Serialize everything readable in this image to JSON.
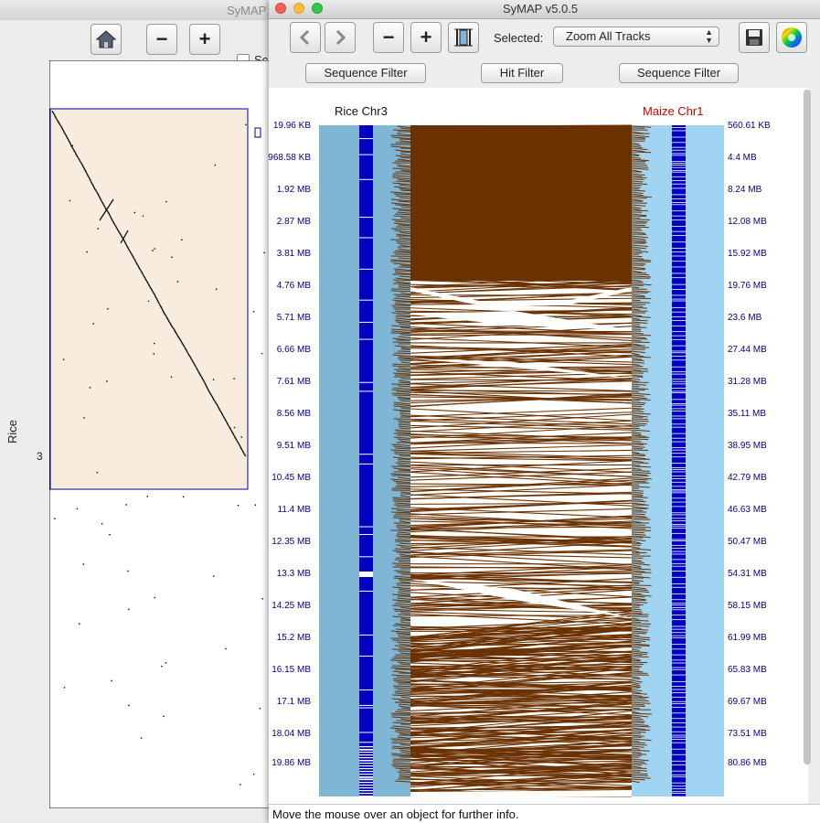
{
  "back_window": {
    "title": "SyMAP",
    "checkbox_label": "Sc",
    "y_axis_label": "Rice",
    "chromosome_label": "3",
    "icons": [
      "home-icon",
      "zoom-out-icon",
      "zoom-in-icon"
    ]
  },
  "window": {
    "title": "SyMAP v5.0.5",
    "controls": [
      "close",
      "minimize",
      "zoom"
    ],
    "colors": {
      "close": "#fc605c",
      "minimize": "#fdbc40",
      "zoom": "#34c84a"
    }
  },
  "toolbar": {
    "selected_label": "Selected:",
    "zoom_select_value": "Zoom All Tracks",
    "icons": [
      "back-arrow-icon",
      "forward-arrow-icon",
      "zoom-out-icon",
      "zoom-in-icon",
      "fit-track-icon",
      "save-icon",
      "color-wheel-icon"
    ]
  },
  "filters": {
    "left_sequence_filter": "Sequence Filter",
    "hit_filter": "Hit Filter",
    "right_sequence_filter": "Sequence Filter"
  },
  "tracks": {
    "reference": {
      "title": "Rice Chr3",
      "ticks": [
        "19.96 KB",
        "968.58 KB",
        "1.92 MB",
        "2.87 MB",
        "3.81 MB",
        "4.76 MB",
        "5.71 MB",
        "6.66 MB",
        "7.61 MB",
        "8.56 MB",
        "9.51 MB",
        "10.45 MB",
        "11.4 MB",
        "12.35 MB",
        "13.3 MB",
        "14.25 MB",
        "15.2 MB",
        "16.15 MB",
        "17.1 MB",
        "18.04 MB",
        "19.86 MB"
      ],
      "color": "#7fb6d6",
      "band_color": "#0000c0"
    },
    "query": {
      "title": "Maize Chr1",
      "ticks": [
        "560.61 KB",
        "4.4 MB",
        "8.24 MB",
        "12.08 MB",
        "15.92 MB",
        "19.76 MB",
        "23.6 MB",
        "27.44 MB",
        "31.28 MB",
        "35.11 MB",
        "38.95 MB",
        "42.79 MB",
        "46.63 MB",
        "50.47 MB",
        "54.31 MB",
        "58.15 MB",
        "61.99 MB",
        "65.83 MB",
        "69.67 MB",
        "73.51 MB",
        "80.86 MB"
      ],
      "color": "#a0d4f2",
      "band_color": "#0000c0"
    },
    "hit_color": "#6b3200"
  },
  "status": {
    "text": "Move the mouse over an object for further info."
  }
}
